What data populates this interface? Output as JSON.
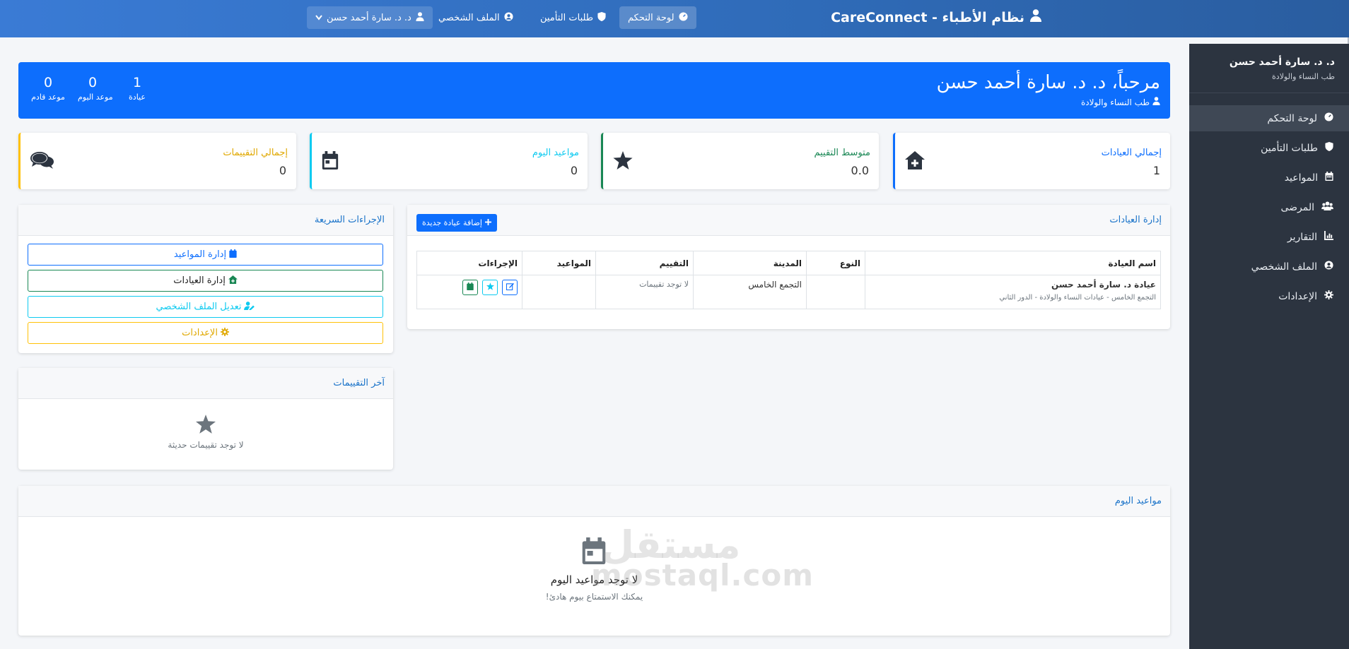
{
  "navbar": {
    "brand": "نظام الأطباء - CareConnect",
    "items": [
      {
        "label": "لوحة التحكم"
      },
      {
        "label": "طلبات التأمين"
      },
      {
        "label": "الملف الشخصي"
      }
    ],
    "user": "د. د. سارة أحمد حسن"
  },
  "sidebar": {
    "name": "د. د. سارة أحمد حسن",
    "specialty": "طب النساء والولادة",
    "items": [
      {
        "label": "لوحة التحكم",
        "icon": "dashboard-icon"
      },
      {
        "label": "طلبات التأمين",
        "icon": "shield-icon"
      },
      {
        "label": "المواعيد",
        "icon": "calendar-icon"
      },
      {
        "label": "المرضى",
        "icon": "users-icon"
      },
      {
        "label": "التقارير",
        "icon": "chart-icon"
      },
      {
        "label": "الملف الشخصي",
        "icon": "user-circle-icon"
      },
      {
        "label": "الإعدادات",
        "icon": "gear-icon"
      }
    ]
  },
  "welcome": {
    "title": "مرحباً، د. د. سارة أحمد حسن",
    "specialty": "طب النساء والولادة",
    "stats": [
      {
        "value": "1",
        "label": "عيادة"
      },
      {
        "value": "0",
        "label": "موعد اليوم"
      },
      {
        "value": "0",
        "label": "موعد قادم"
      }
    ]
  },
  "cards": [
    {
      "label": "إجمالي العيادات",
      "value": "1",
      "icon": "clinic-icon",
      "color": "#0d6efd"
    },
    {
      "label": "متوسط التقييم",
      "value": "0.0",
      "icon": "star-icon",
      "color": "#198754"
    },
    {
      "label": "مواعيد اليوم",
      "value": "0",
      "icon": "calendar-icon",
      "color": "#0dcaf0"
    },
    {
      "label": "إجمالي التقييمات",
      "value": "0",
      "icon": "comments-icon",
      "color": "#ffc107"
    }
  ],
  "clinics_panel": {
    "title": "إدارة العيادات",
    "add_button": "إضافة عيادة جديدة",
    "columns": [
      "اسم العيادة",
      "النوع",
      "المدينة",
      "التقييم",
      "المواعيد",
      "الإجراءات"
    ],
    "rows": [
      {
        "name": "عيادة د. سارة أحمد حسن",
        "address": "التجمع الخامس - عيادات النساء والولادة - الدور الثاني",
        "type": "",
        "city": "التجمع الخامس",
        "rating": "لا توجد تقييمات",
        "appointments": ""
      }
    ]
  },
  "quick_actions": {
    "title": "الإجراءات السريعة",
    "buttons": [
      {
        "label": "إدارة المواعيد",
        "color": "#0d6efd"
      },
      {
        "label": "إدارة العيادات",
        "color": "#198754"
      },
      {
        "label": "تعديل الملف الشخصي",
        "color": "#0dcaf0"
      },
      {
        "label": "الإعدادات",
        "color": "#ffc107"
      }
    ]
  },
  "reviews_panel": {
    "title": "آخر التقييمات",
    "empty": "لا توجد تقييمات حديثة"
  },
  "today_panel": {
    "title": "مواعيد اليوم",
    "empty_title": "لا توجد مواعيد اليوم",
    "empty_sub": "يمكنك الاستمتاع بيوم هادئ!"
  },
  "watermark": {
    "latin": "mostaql.com",
    "arabic": "مستقل"
  }
}
